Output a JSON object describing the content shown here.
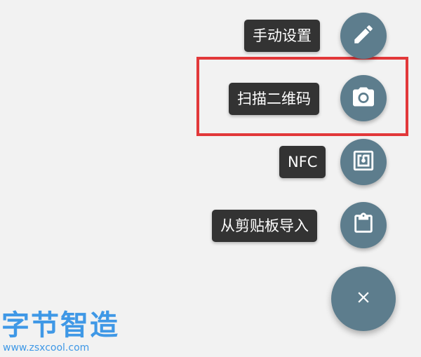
{
  "menu": {
    "items": [
      {
        "label": "手动设置",
        "icon": "pencil-icon"
      },
      {
        "label": "扫描二维码",
        "icon": "camera-icon"
      },
      {
        "label": "NFC",
        "icon": "nfc-icon"
      },
      {
        "label": "从剪贴板导入",
        "icon": "clipboard-icon"
      }
    ],
    "close_icon": "close-icon"
  },
  "highlight": {
    "target": "扫描二维码",
    "color": "#e2383a"
  },
  "watermark": {
    "title": "字节智造",
    "url": "www.zsxcool.com",
    "color": "#3f98e6"
  },
  "colors": {
    "fab": "#5d7d8d",
    "label_bg": "#333333",
    "label_text": "#ffffff",
    "background": "#f2f2f2"
  }
}
